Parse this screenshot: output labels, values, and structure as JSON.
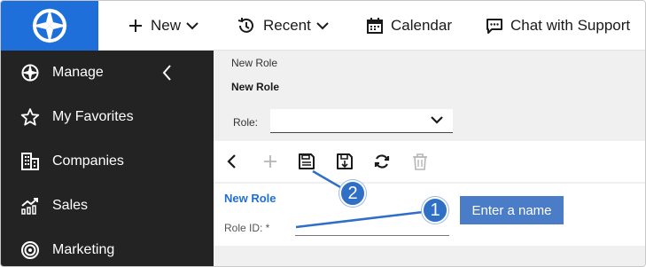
{
  "topbar": {
    "new_label": "New",
    "recent_label": "Recent",
    "calendar_label": "Calendar",
    "chat_label": "Chat with Support"
  },
  "sidebar": {
    "items": [
      {
        "label": "Manage",
        "icon": "compass-icon"
      },
      {
        "label": "My Favorites",
        "icon": "star-icon"
      },
      {
        "label": "Companies",
        "icon": "building-icon"
      },
      {
        "label": "Sales",
        "icon": "chart-icon"
      },
      {
        "label": "Marketing",
        "icon": "target-icon"
      }
    ]
  },
  "main": {
    "breadcrumb": "New Role",
    "title": "New Role",
    "role_filter_label": "Role:",
    "role_filter_value": "",
    "form_title": "New Role",
    "role_id_label": "Role ID: *",
    "role_id_value": ""
  },
  "toolbar": {
    "buttons": [
      "back-icon",
      "add-icon",
      "save-icon",
      "save-close-icon",
      "refresh-icon",
      "delete-icon"
    ]
  },
  "annotations": {
    "step1": "1",
    "step2": "2",
    "callout_text": "Enter a name"
  },
  "colors": {
    "brand_blue": "#1e6fd9",
    "sidebar_bg": "#232323",
    "badge_blue": "#2f6fc6",
    "callout_blue": "#4a7cc7"
  }
}
